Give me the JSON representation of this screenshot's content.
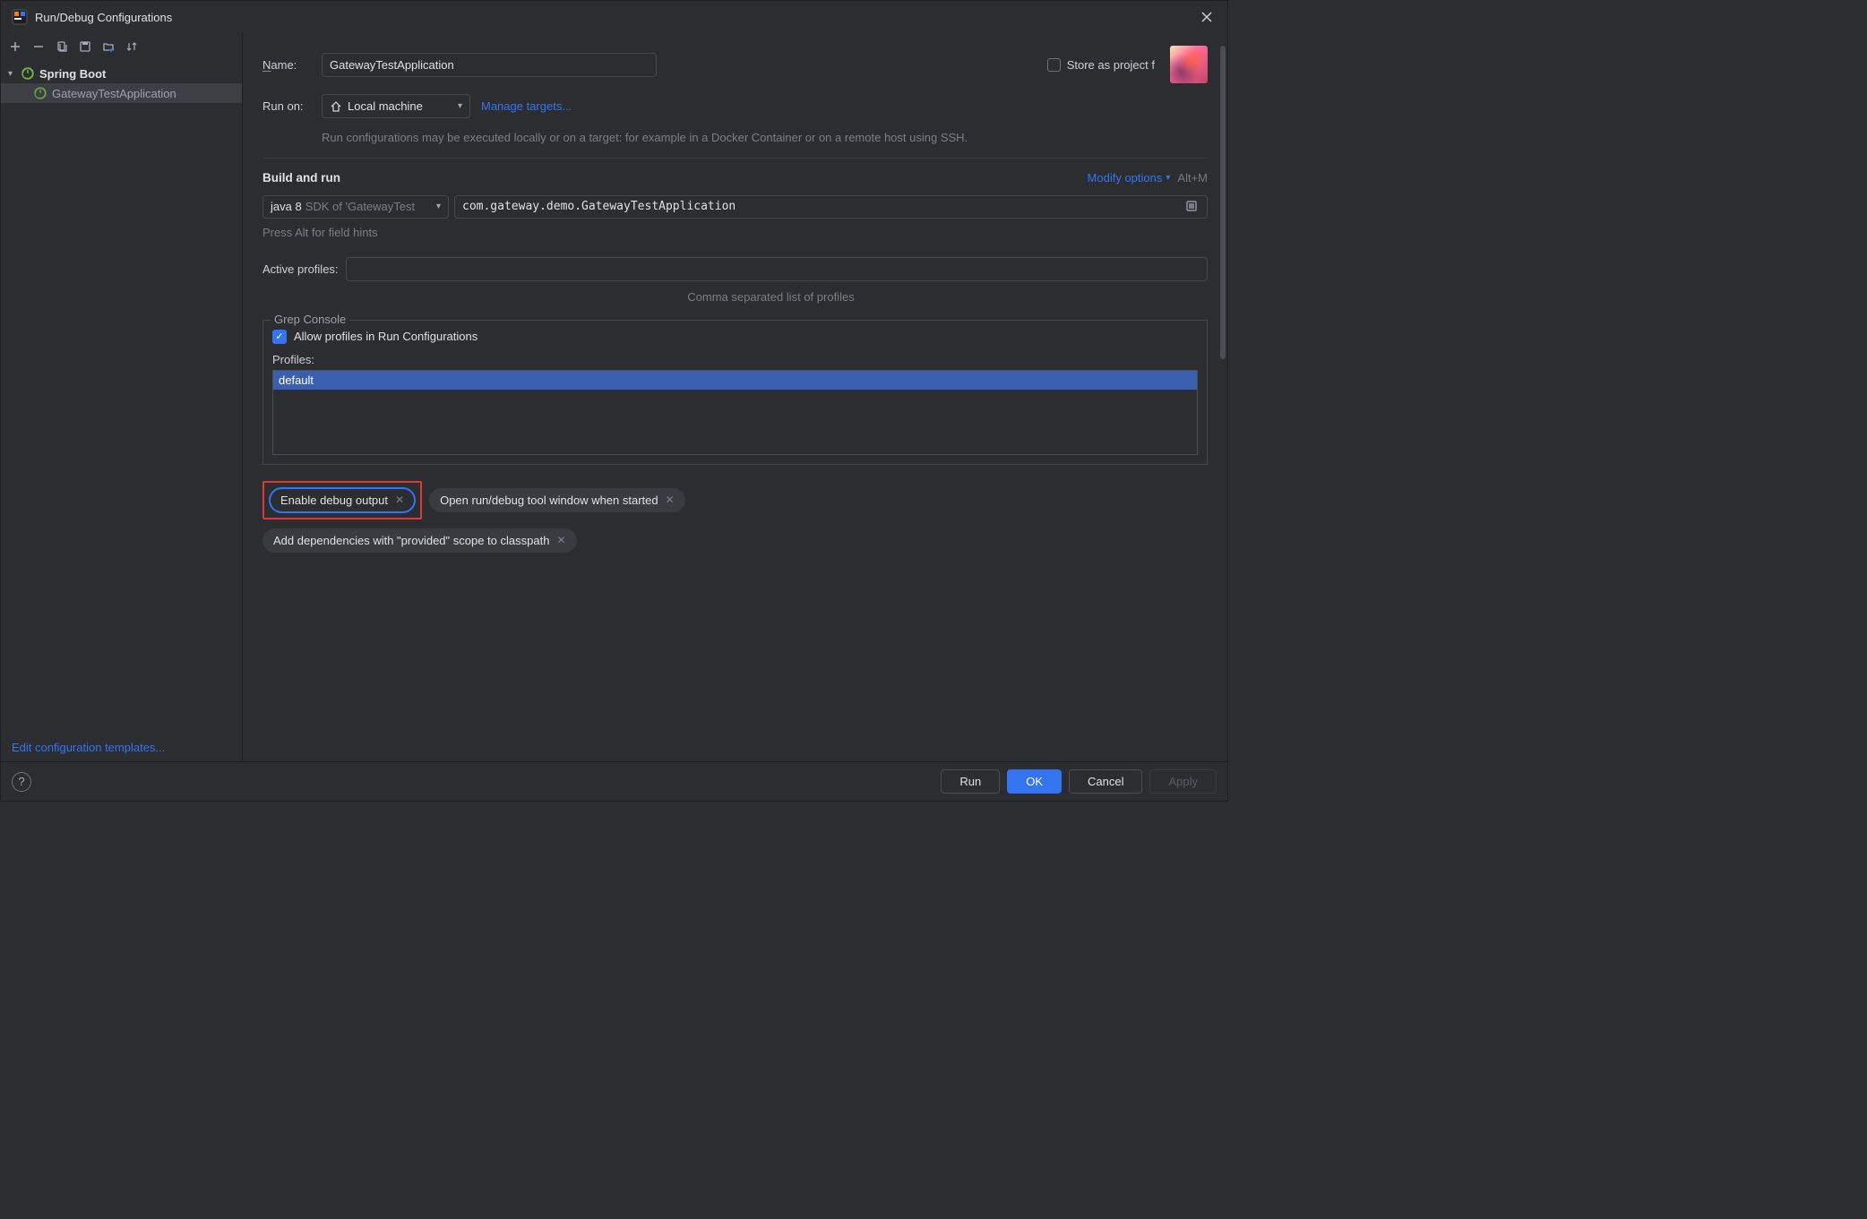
{
  "titlebar": {
    "title": "Run/Debug Configurations"
  },
  "tree": {
    "root_label": "Spring Boot",
    "item_label": "GatewayTestApplication"
  },
  "form": {
    "name_label": "Name:",
    "name_value": "GatewayTestApplication",
    "store_label": "Store as project f",
    "store_underline": "S",
    "run_on_label": "Run on:",
    "run_on_value": "Local machine",
    "manage_targets": "Manage targets...",
    "run_on_help": "Run configurations may be executed locally or on a target: for example in a Docker Container or on a remote host using SSH.",
    "build_run_title": "Build and run",
    "modify_options": "Modify options",
    "modify_underline": "M",
    "modify_shortcut": "Alt+M",
    "jdk_main": "java 8",
    "jdk_sub": "SDK of 'GatewayTest",
    "main_class": "com.gateway.demo.GatewayTestApplication",
    "field_hint": "Press Alt for field hints",
    "active_profiles_label": "Active profiles:",
    "profiles_hint": "Comma separated list of profiles",
    "grep_legend": "Grep Console",
    "allow_profiles": "Allow profiles in Run Configurations",
    "profiles_list_label": "Profiles:",
    "profiles_list_item": "default",
    "chip_debug": "Enable debug output",
    "chip_debug_underline": "d",
    "chip_tool_window": "Open run/debug tool window when started",
    "chip_deps": "Add dependencies with \"provided\" scope to classpath"
  },
  "links": {
    "edit_templates": "Edit configuration templates..."
  },
  "footer": {
    "run": "Run",
    "ok": "OK",
    "cancel": "Cancel",
    "apply": "Apply"
  }
}
